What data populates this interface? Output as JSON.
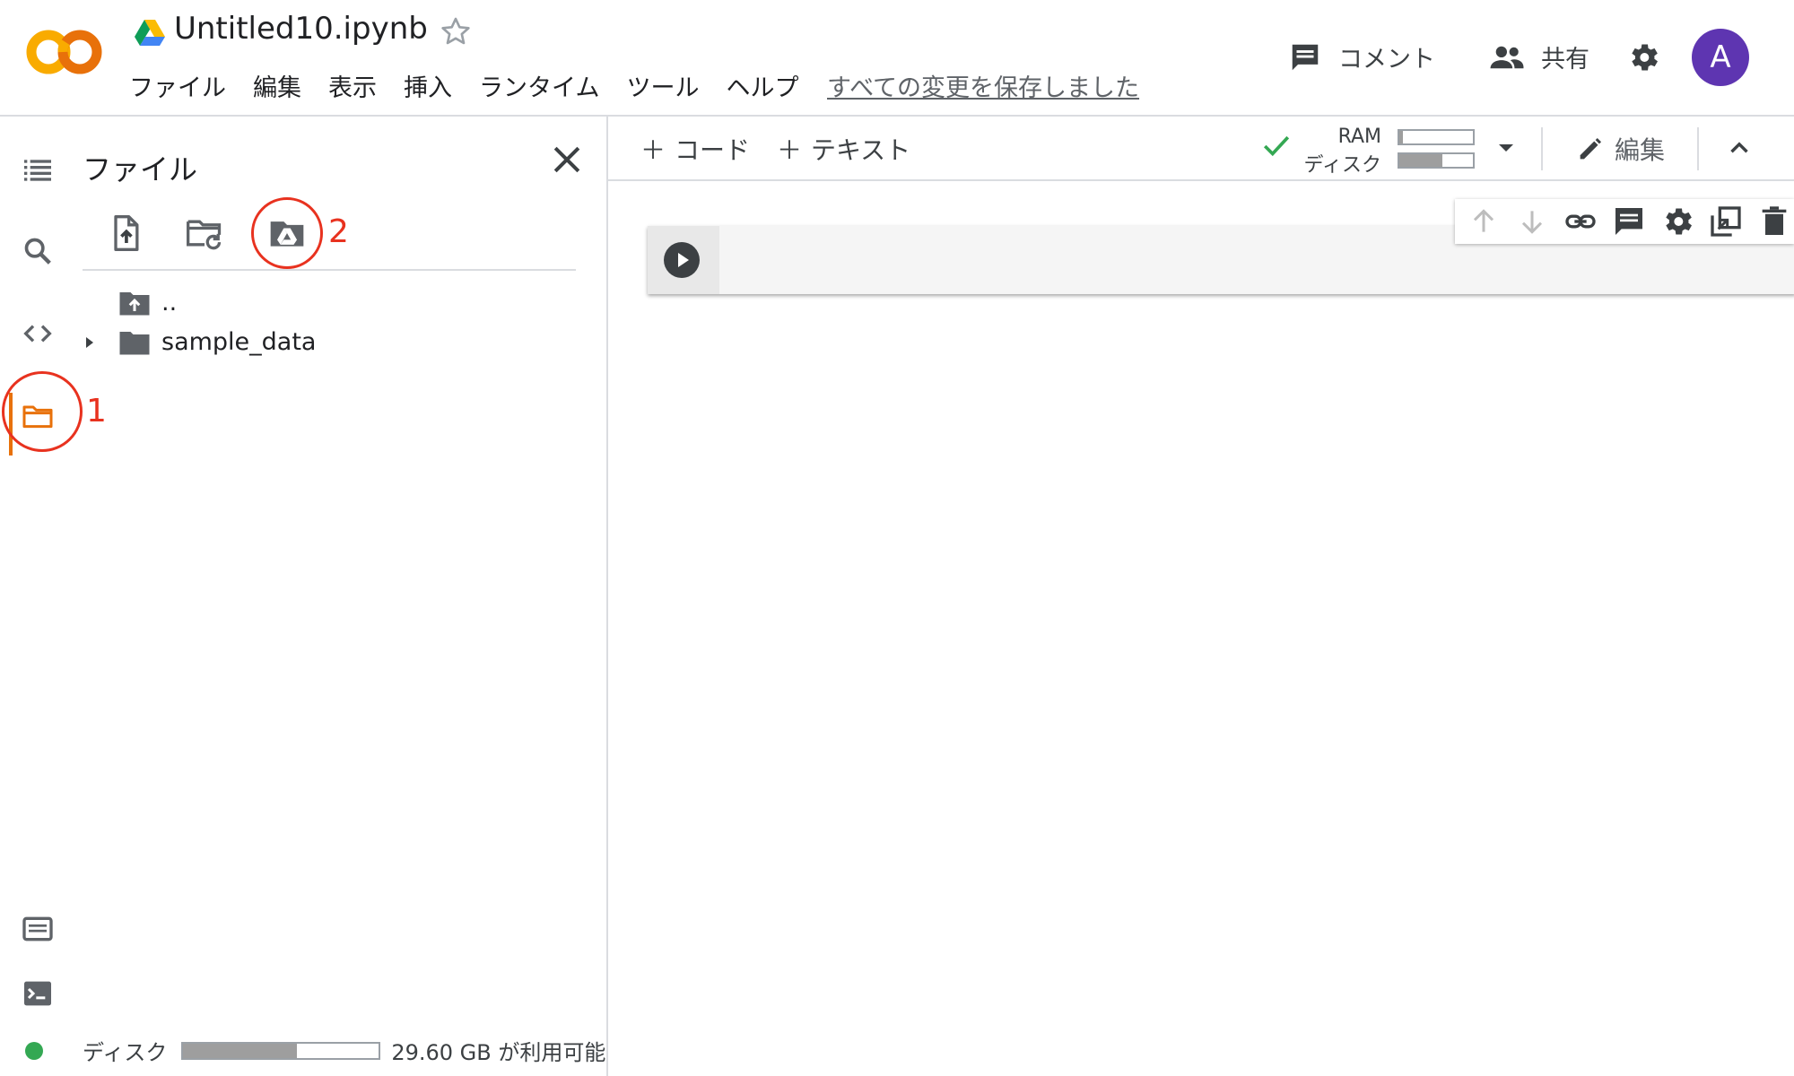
{
  "header": {
    "notebook_title": "Untitled10.ipynb",
    "menu": [
      "ファイル",
      "編集",
      "表示",
      "挿入",
      "ランタイム",
      "ツール",
      "ヘルプ"
    ],
    "saved_status": "すべての変更を保存しました",
    "comment_label": "コメント",
    "share_label": "共有",
    "avatar_letter": "A",
    "avatar_color": "#5e35b1"
  },
  "panel": {
    "title": "ファイル",
    "tree": [
      {
        "name": "..",
        "type": "parent-folder"
      },
      {
        "name": "sample_data",
        "type": "folder",
        "expandable": true
      }
    ],
    "disk_label": "ディスク",
    "disk_free": "29.60 GB が利用可能",
    "disk_fill": 0.58
  },
  "annotations": {
    "num1": "1",
    "num2": "2",
    "color": "#e8321f"
  },
  "main": {
    "add_code": "コード",
    "add_text": "テキスト",
    "ram_label": "RAM",
    "disk_label": "ディスク",
    "ram_fill": 0.05,
    "disk_fill": 0.58,
    "edit_label": "編集"
  },
  "icons": {
    "rail": [
      "toc-icon",
      "search-icon",
      "code-snippets-icon",
      "folder-icon",
      "command-palette-icon",
      "terminal-icon"
    ],
    "panel_toolbar": [
      "upload-file-icon",
      "refresh-folder-icon",
      "mount-drive-icon"
    ],
    "cell_toolbar": [
      "move-up-icon",
      "move-down-icon",
      "link-icon",
      "comment-icon",
      "settings-icon",
      "mirror-cell-icon",
      "delete-icon"
    ]
  },
  "colors": {
    "accent_orange": "#e8710a",
    "connected_green": "#34a853"
  }
}
